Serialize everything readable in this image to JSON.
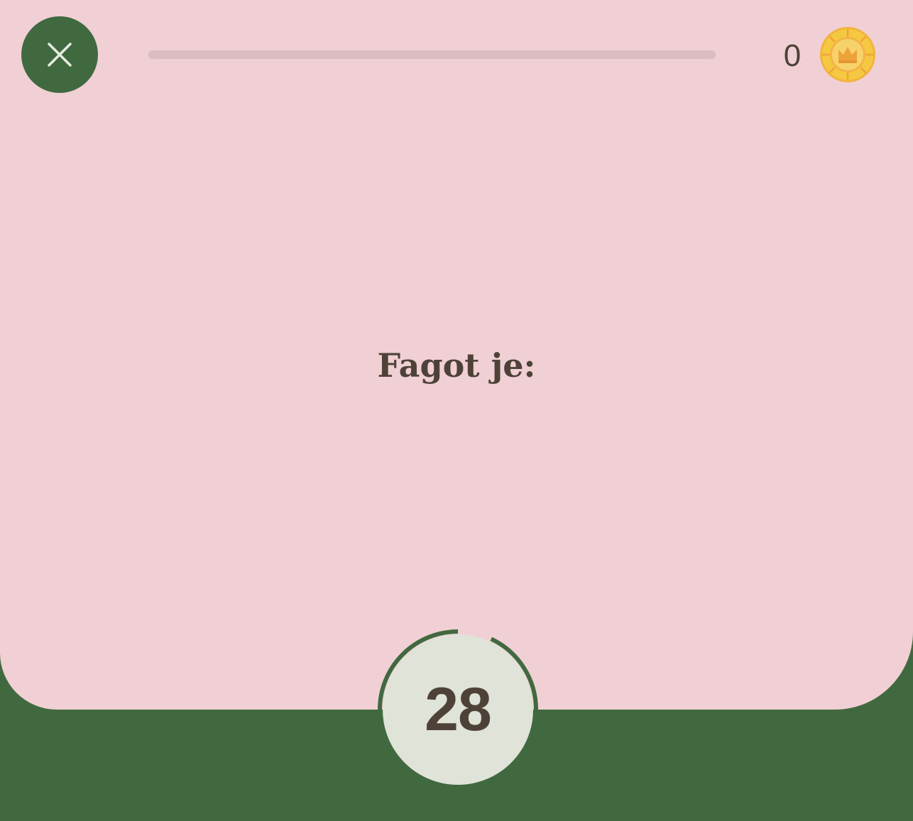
{
  "header": {
    "close_icon": "close-icon",
    "progress": 0,
    "coins": "0",
    "coin_icon": "crown-coin-icon"
  },
  "question": {
    "text": "Fagot je:"
  },
  "timer": {
    "value": "28",
    "remaining_fraction": 0.93
  },
  "colors": {
    "card_background": "#f0d0d5",
    "page_background": "#416940",
    "accent_green": "#416940",
    "text": "#4e4238",
    "timer_fill": "#dfe3d8",
    "progress_track": "#dbbcc2",
    "coin_gold": "#f5c842"
  }
}
